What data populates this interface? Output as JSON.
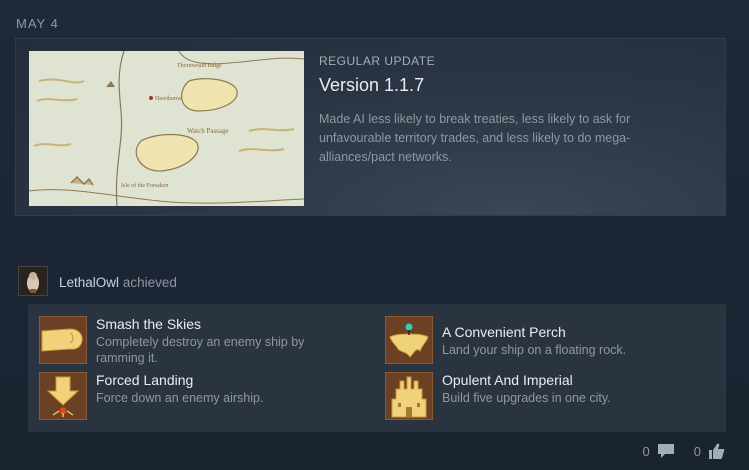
{
  "date": "MAY 4",
  "news": {
    "kind": "REGULAR UPDATE",
    "title": "Version 1.1.7",
    "body": "Made AI less likely to break treaties, less likely to ask for unfavourable territory trades, and less likely to do mega-alliances/pact networks.",
    "map_labels": [
      "Thornweald Ridge",
      "Hawthorne",
      "Watch Passage",
      "Isle of the Forsaken"
    ]
  },
  "achiever": {
    "name": "LethalOwl",
    "action": "achieved"
  },
  "achievements": [
    {
      "title": "Smash the Skies",
      "desc": "Completely destroy an enemy ship by ramming it.",
      "icon": "fist-icon"
    },
    {
      "title": "A Convenient Perch",
      "desc": "Land your ship on a floating rock.",
      "icon": "floating-rock-icon"
    },
    {
      "title": "Forced Landing",
      "desc": "Force down an enemy airship.",
      "icon": "down-arrow-crash-icon"
    },
    {
      "title": "Opulent And Imperial",
      "desc": "Build five upgrades in one city.",
      "icon": "palace-icon"
    }
  ],
  "footer": {
    "comments": "0",
    "likes": "0"
  }
}
